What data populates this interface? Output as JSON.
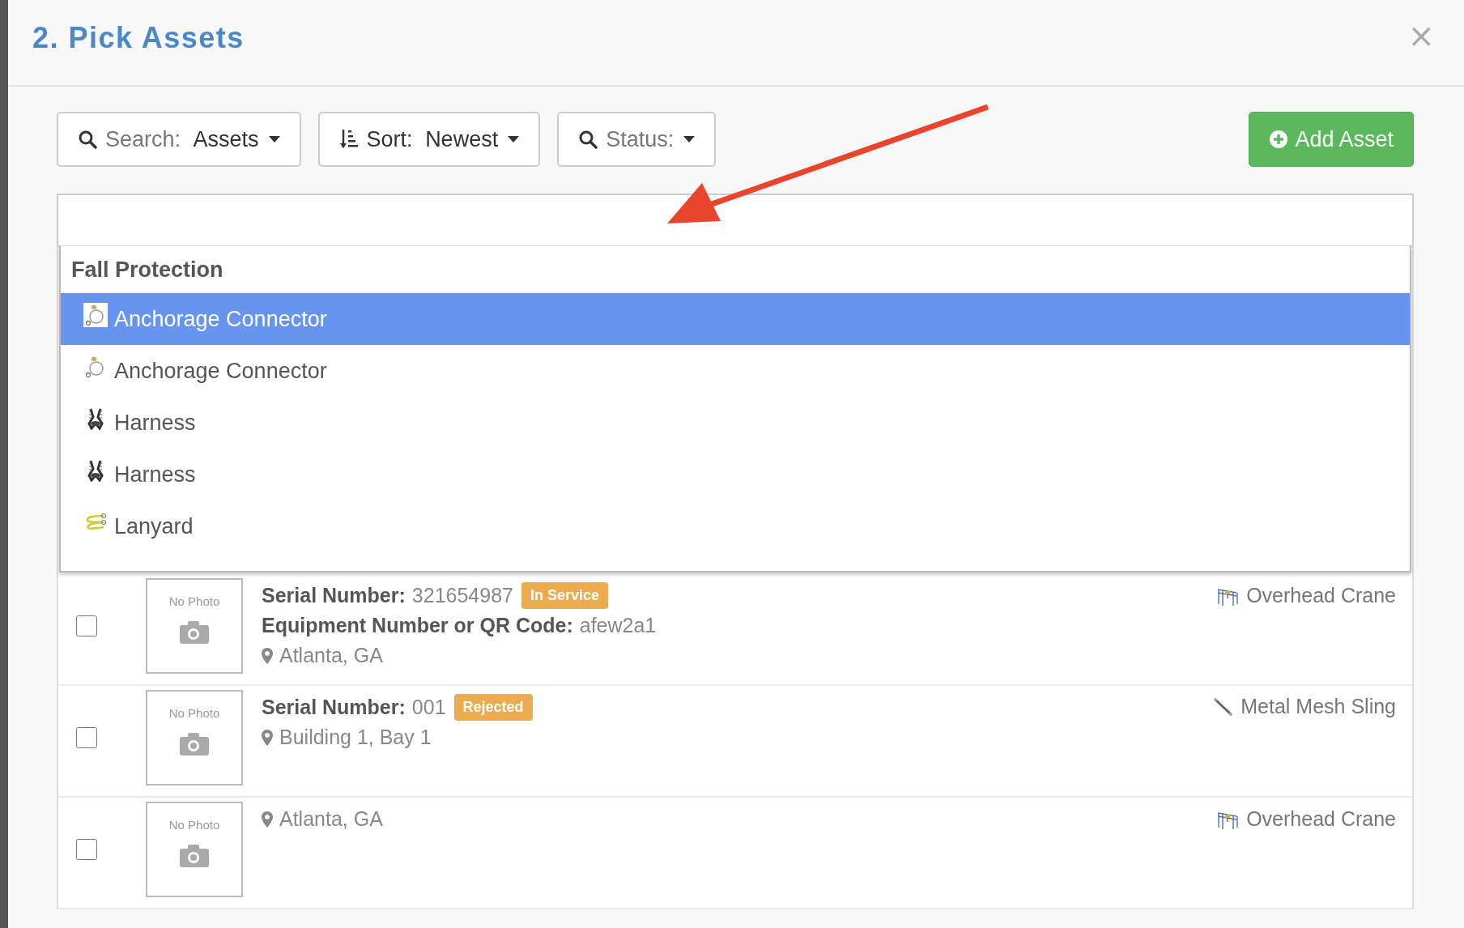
{
  "dialog": {
    "title": "2. Pick Assets",
    "close": "×"
  },
  "toolbar": {
    "filters": [
      {
        "kind": "search",
        "label": "Search:",
        "value": "Assets"
      },
      {
        "kind": "sort",
        "label": "Sort:",
        "value": "Newest"
      },
      {
        "kind": "search",
        "label": "Status:"
      }
    ],
    "add_button": "Add Asset"
  },
  "dropdown": {
    "group": "Fall Protection",
    "items": [
      {
        "label": "Anchorage Connector",
        "kind": "connector",
        "selected": true
      },
      {
        "label": "Anchorage Connector",
        "kind": "connector",
        "selected": false
      },
      {
        "label": "Harness",
        "kind": "harness",
        "selected": false
      },
      {
        "label": "Harness",
        "kind": "harness",
        "selected": false
      },
      {
        "label": "Lanyard",
        "kind": "lanyard",
        "selected": false
      }
    ]
  },
  "assets": [
    {
      "checked": false,
      "photo": "No Photo",
      "lines": [
        {
          "kind": "field",
          "label": "Serial Number:",
          "value": "321654987",
          "badge": "In Service"
        },
        {
          "kind": "field",
          "label": "Equipment Number or QR Code:",
          "value": "afew2a1"
        },
        {
          "kind": "location",
          "value": "Atlanta, GA"
        }
      ],
      "type": {
        "kind": "crane",
        "label": "Overhead Crane"
      }
    },
    {
      "checked": false,
      "photo": "No Photo",
      "lines": [
        {
          "kind": "field",
          "label": "Serial Number:",
          "value": "001",
          "badge": "Rejected"
        },
        {
          "kind": "location",
          "value": "Building 1, Bay 1"
        }
      ],
      "type": {
        "kind": "sling",
        "label": "Metal Mesh Sling"
      }
    },
    {
      "checked": false,
      "photo": "No Photo",
      "lines": [
        {
          "kind": "location",
          "value": "Atlanta, GA"
        }
      ],
      "type": {
        "kind": "crane",
        "label": "Overhead Crane"
      }
    }
  ]
}
